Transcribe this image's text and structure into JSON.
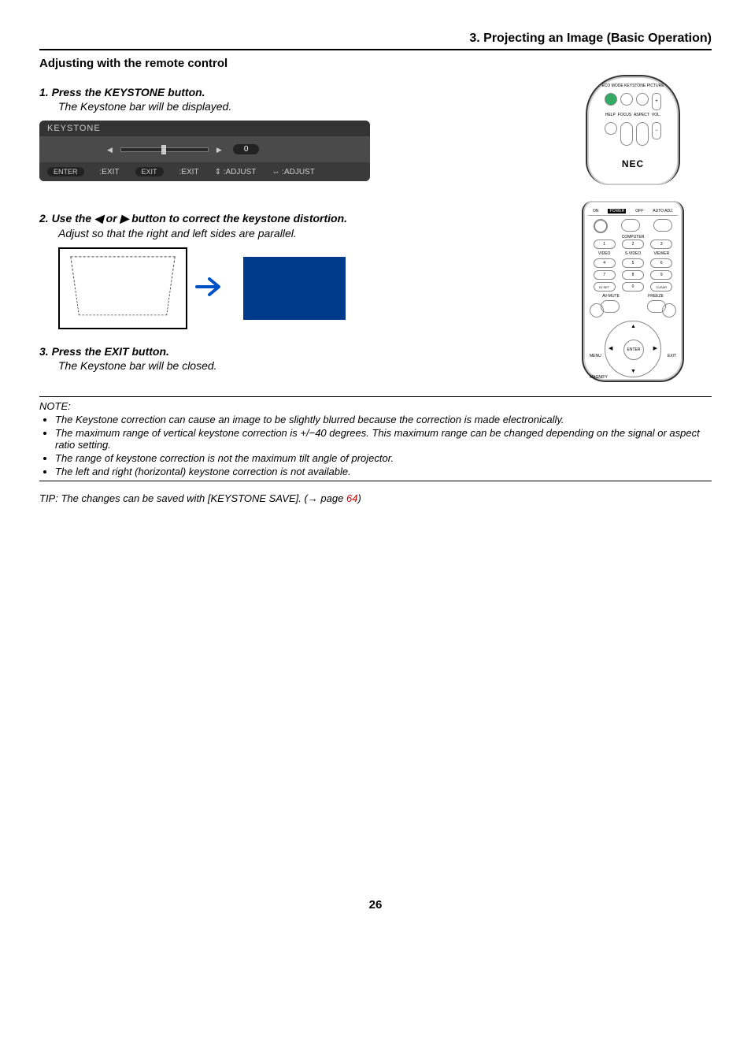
{
  "section_title": "3. Projecting an Image (Basic Operation)",
  "subhead": "Adjusting with the remote control",
  "steps": {
    "s1": {
      "title": "1.  Press the KEYSTONE button.",
      "desc": "The Keystone bar will be displayed."
    },
    "s2": {
      "title": "2.  Use the ◀ or ▶ button to correct the keystone distortion.",
      "desc": "Adjust so that the right and left sides are parallel."
    },
    "s3": {
      "title": "3.  Press the EXIT button.",
      "desc": "The Keystone bar will be closed."
    }
  },
  "osd": {
    "title": "KEYSTONE",
    "value": "0",
    "footer": {
      "enter_pill": "ENTER",
      "enter_txt": ":EXIT",
      "exit_pill": "EXIT",
      "exit_txt": ":EXIT",
      "ud": "⇕ :ADJUST",
      "lr": "⇔ :ADJUST"
    }
  },
  "note_label": "NOTE:",
  "notes": [
    "The Keystone correction can cause an image to be slightly blurred because the correction is made electronically.",
    "The maximum range of vertical keystone correction is +/−40 degrees. This maximum range can be changed depending on the signal or aspect ratio setting.",
    "The  range of keystone correction is not the maximum tilt angle of projector.",
    "The left and right (horizontal) keystone correction is not available."
  ],
  "tip_pre": "TIP: The changes can be saved with [KEYSTONE SAVE]. (→ page ",
  "tip_link": "64",
  "tip_post": ")",
  "page_number": "26",
  "remote_top": {
    "row1": [
      "ECO MODE",
      "KEYSTONE",
      "PICTURE",
      ""
    ],
    "row2": [
      "HELP",
      "FOCUS",
      "ASPECT",
      "VOL."
    ],
    "brand": "NEC"
  },
  "remote_full": {
    "on": "ON",
    "power": "POWER",
    "off": "OFF",
    "auto": "AUTO ADJ.",
    "comp": "COMPUTER",
    "r1": [
      "1",
      "2",
      "3"
    ],
    "r1l": [
      "",
      "",
      ""
    ],
    "r2l": [
      "VIDEO",
      "S-VIDEO",
      "VIEWER"
    ],
    "r2": [
      "4",
      "5",
      "6"
    ],
    "r3": [
      "7",
      "8",
      "9"
    ],
    "r4": [
      "ID SET",
      "0",
      "CLEAR"
    ],
    "av": "AV-MUTE",
    "freeze": "FREEZE",
    "menu": "MENU",
    "exit": "EXIT",
    "enter": "ENTER",
    "magnify": "MAGNIFY"
  }
}
